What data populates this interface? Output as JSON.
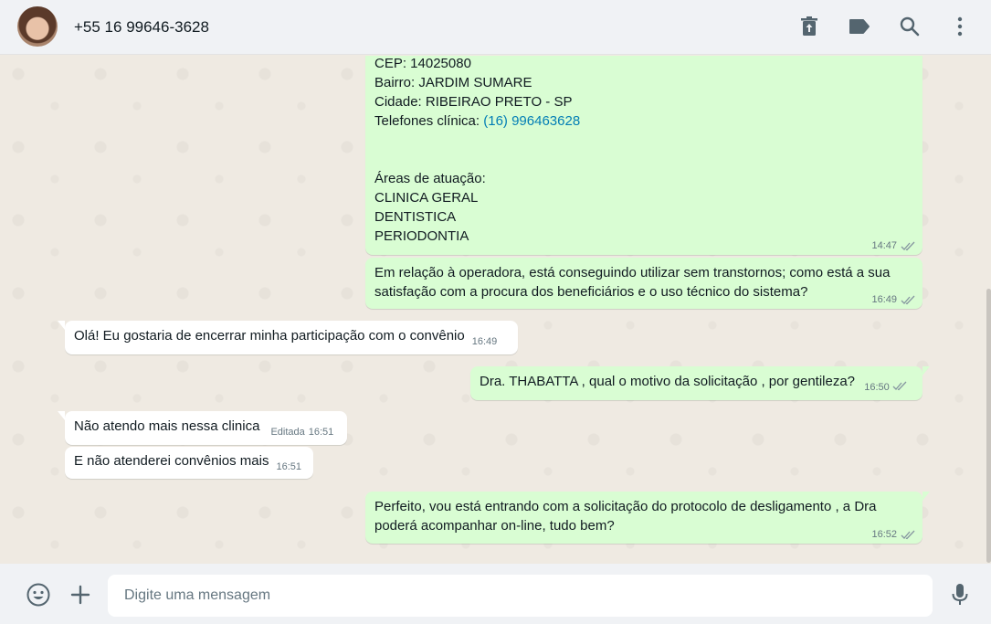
{
  "header": {
    "contact_name": "+55 16 99646-3628",
    "icons": [
      "delete-icon",
      "label-icon",
      "search-icon",
      "menu-icon"
    ]
  },
  "messages": {
    "m1": {
      "lines": [
        "CEP: 14025080",
        "Bairro: JARDIM SUMARE",
        "Cidade: RIBEIRAO PRETO - SP"
      ],
      "phone_label": "Telefones clínica: ",
      "phone_link": "(16) 996463628",
      "areas_title": "Áreas de atuação:",
      "areas": [
        "CLINICA GERAL",
        "DENTISTICA",
        "PERIODONTIA"
      ],
      "time": "14:47"
    },
    "m2": {
      "line1": "Em relação à operadora, está conseguindo utilizar sem transtornos; como está a sua",
      "line2": "satisfação com a procura dos beneficiários e o uso técnico do sistema?",
      "time": "16:49"
    },
    "m3": {
      "text": "Olá! Eu gostaria de encerrar minha participação com o convênio",
      "time": "16:49"
    },
    "m4": {
      "text": "Dra. THABATTA , qual o motivo da solicitação , por gentileza?",
      "time": "16:50"
    },
    "m5": {
      "text": "Não atendo mais nessa clinica",
      "edited": "Editada",
      "time": "16:51"
    },
    "m6": {
      "text": "E não atenderei convênios mais",
      "time": "16:51"
    },
    "m7": {
      "line1": "Perfeito, vou está entrando com a solicitação do protocolo de desligamento , a Dra",
      "line2": "poderá acompanhar on-line, tudo bem?",
      "time": "16:52"
    }
  },
  "footer": {
    "placeholder": "Digite uma mensagem",
    "icons": [
      "emoji-icon",
      "plus-icon",
      "mic-icon"
    ]
  },
  "colors": {
    "outgoing": "#d9fdd3",
    "incoming": "#ffffff",
    "background": "#efeae2",
    "link": "#027eb5"
  }
}
